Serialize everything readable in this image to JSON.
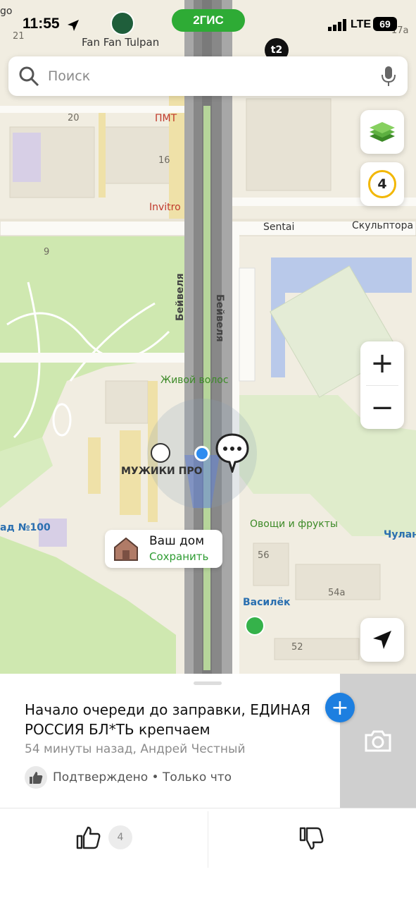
{
  "status_bar": {
    "time": "11:55",
    "network": "LTE",
    "battery": "69",
    "app_pill": "2ГИС"
  },
  "search": {
    "placeholder": "Поиск"
  },
  "map": {
    "places": {
      "fan_fan_tulpan": "Fan Fan Tulpan",
      "pmt": "ПМТ",
      "invitro": "Invitro",
      "sentai": "Sentai",
      "skulptora": "Скульптора",
      "zhivoy_volos": "Живой волос",
      "muzhiki_pro": "МУЖИКИ ПРО",
      "ovoshchi": "Овощи и фрукты",
      "vasilek": "Василёк",
      "chulan": "Чулан",
      "sad_100": "ад №100"
    },
    "streets": {
      "left": "Бейвеля",
      "right": "Бейвеля"
    },
    "house_numbers": [
      "go",
      "21",
      "17a",
      "20",
      "16",
      "9",
      "56",
      "54а",
      "52"
    ],
    "traffic_level": "4"
  },
  "home_card": {
    "title": "Ваш дом",
    "action": "Сохранить"
  },
  "event": {
    "title": "Начало очереди до заправки, ЕДИНАЯ РОССИЯ БЛ*ТЬ крепчаем",
    "meta": "54 минуты назад, Андрей Честный",
    "confirmation": "Подтверждено • Только что",
    "likes": "4",
    "add_label": "+"
  },
  "icons": {
    "search": "search-icon",
    "mic": "mic-icon",
    "layers": "layers-icon",
    "zoom_in": "plus-icon",
    "zoom_out": "minus-icon",
    "locate": "navigation-arrow-icon",
    "camera": "camera-icon",
    "thumbs_up": "thumbs-up-icon",
    "thumbs_down": "thumbs-down-icon",
    "house": "house-icon",
    "chat_bubble": "chat-bubble-icon",
    "location_dot": "location-dot-icon"
  },
  "colors": {
    "brand_green": "#2eab35",
    "accent_blue": "#1d7fe0",
    "map_bg": "#f1ede1",
    "park": "#cfe8b0"
  }
}
